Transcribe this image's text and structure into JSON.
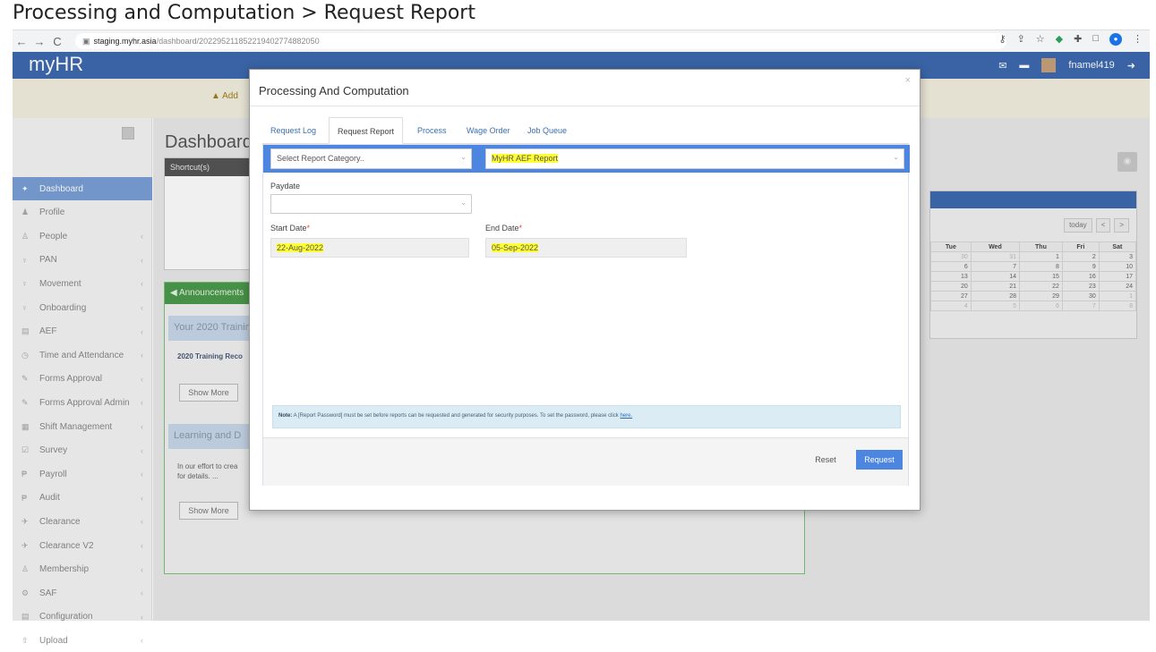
{
  "heading": "Processing and Computation > Request Report",
  "browser": {
    "nav": [
      "←",
      "→",
      "C"
    ],
    "url_host": "staging.myhr.asia",
    "url_path": "/dashboard/2022952118522194027748820​50"
  },
  "app": {
    "logo": "myHR",
    "user": "fnamel419",
    "banner_icon": "▲",
    "banner_text": "Add"
  },
  "sidebar": {
    "items": [
      {
        "label": "Dashboard",
        "icon": "home-icon",
        "glyph": "✦"
      },
      {
        "label": "Profile",
        "icon": "person-icon",
        "glyph": "♟"
      },
      {
        "label": "People",
        "icon": "people-icon",
        "glyph": "♙"
      },
      {
        "label": "PAN",
        "icon": "pan-icon",
        "glyph": "♀"
      },
      {
        "label": "Movement",
        "icon": "movement-icon",
        "glyph": "♀"
      },
      {
        "label": "Onboarding",
        "icon": "onboarding-icon",
        "glyph": "♀"
      },
      {
        "label": "AEF",
        "icon": "folder-icon",
        "glyph": "▤"
      },
      {
        "label": "Time and Attendance",
        "icon": "clock-icon",
        "glyph": "◷"
      },
      {
        "label": "Forms Approval",
        "icon": "pencil-icon",
        "glyph": "✎"
      },
      {
        "label": "Forms Approval Admin",
        "icon": "pencil-icon",
        "glyph": "✎"
      },
      {
        "label": "Shift Management",
        "icon": "calendar-icon",
        "glyph": "▦"
      },
      {
        "label": "Survey",
        "icon": "survey-icon",
        "glyph": "☑"
      },
      {
        "label": "Payroll",
        "icon": "payroll-icon",
        "glyph": "₱"
      },
      {
        "label": "Audit",
        "icon": "audit-icon",
        "glyph": "₱"
      },
      {
        "label": "Clearance",
        "icon": "clearance-icon",
        "glyph": "✈"
      },
      {
        "label": "Clearance V2",
        "icon": "clearance-icon",
        "glyph": "✈"
      },
      {
        "label": "Membership",
        "icon": "membership-icon",
        "glyph": "♙"
      },
      {
        "label": "SAF",
        "icon": "gear-icon",
        "glyph": "⚙"
      },
      {
        "label": "Configuration",
        "icon": "config-icon",
        "glyph": "▤"
      },
      {
        "label": "Upload",
        "icon": "upload-icon",
        "glyph": "⇧"
      }
    ]
  },
  "dashboard": {
    "title": "Dashboard",
    "shortcuts_label": "Shortcut(s)",
    "announcements_label": "Announcements",
    "ann1_title": "Your 2020 Training",
    "ann1_text": "2020 Training Reco",
    "ann2_title": "Learning and D",
    "ann2_text1": "In our effort to crea",
    "ann2_text2": "for details. ...",
    "show_more": "Show More"
  },
  "calendar": {
    "today": "today",
    "prev": "<",
    "next": ">",
    "headers": [
      "Tue",
      "Wed",
      "Thu",
      "Fri",
      "Sat"
    ],
    "rows": [
      [
        "30",
        "31",
        "1",
        "2",
        "3"
      ],
      [
        "6",
        "7",
        "8",
        "9",
        "10"
      ],
      [
        "13",
        "14",
        "15",
        "16",
        "17"
      ],
      [
        "20",
        "21",
        "22",
        "23",
        "24"
      ],
      [
        "27",
        "28",
        "29",
        "30",
        "1"
      ],
      [
        "4",
        "5",
        "6",
        "7",
        "8"
      ]
    ]
  },
  "modal": {
    "title": "Processing And Computation",
    "close": "×",
    "tabs": [
      "Request Log",
      "Request Report",
      "Process",
      "Wage Order",
      "Job Queue"
    ],
    "active_tab": "Request Report",
    "category_placeholder": "Select Report Category..",
    "report_selected": "MyHR AEF Report",
    "paydate_label": "Paydate",
    "start_label": "Start Date",
    "end_label": "End Date",
    "required_mark": "*",
    "start_value": "22-Aug-2022",
    "end_value": "05-Sep-2022",
    "note_label": "Note:",
    "note_text": " A [Report Password] must be set before reports can be requested and generated for security purposes. To set the password, please click ",
    "note_link": "here.",
    "reset_label": "Reset",
    "request_label": "Request"
  }
}
